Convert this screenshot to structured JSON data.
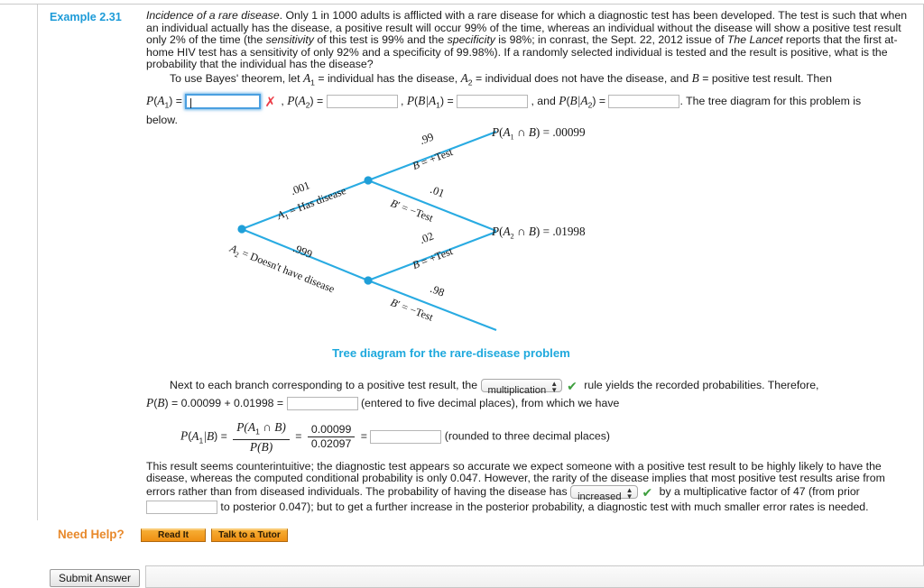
{
  "example": {
    "label": "Example 2.31",
    "title": "Incidence of a rare disease",
    "paragraph_1a": ". Only 1 in 1000 adults is afflicted with a rare disease for which a diagnostic test has been developed. The test is such that when an individual actually has the disease, a positive result will occur 99% of the time, whereas an individual without the disease will show a positive test result only 2% of the time (the ",
    "sensitivity_word": "sensitivity",
    "paragraph_1b": " of this test is 99% and the ",
    "specificity_word": "specificity",
    "paragraph_1c": " is 98%; in conrast, the Sept. 22, 2012 issue of ",
    "lancet": "The Lancet",
    "paragraph_1d": " reports that the first at-home HIV test has a sensitivity of only 92% and a specificity of 99.98%). If a randomly selected individual is tested and the result is positive, what is the probability that the individual has the disease?",
    "bayes_lead": "To use Bayes' theorem, let",
    "bayes_mid1": "= individual has the disease,",
    "bayes_mid2": "= individual does not have the disease, and",
    "bayes_mid3": "= positive test result. Then",
    "below_word": "below."
  },
  "answers": {
    "pa1_label_p": "P",
    "pa1_value": "",
    "pa1_status": "incorrect",
    "pa2_value": "",
    "pba1_value": "",
    "pba2_value": "",
    "pba2_tail": ". The tree diagram for this problem is",
    "pb_value": "",
    "posterior_value": "",
    "prior_value": ""
  },
  "icons": {
    "incorrect_mark": "✗",
    "correct_mark": "✔",
    "select_arrows": "⇅"
  },
  "tree": {
    "caption": "Tree diagram for the rare-disease problem",
    "branches": {
      "p_a1": ".001",
      "a1_label": "= Has disease",
      "p_a2": ".999",
      "a2_label": "= Doesn't have disease",
      "p_b_given_a1": ".99",
      "b_pos_label_1": "= +Test",
      "p_bprime_given_a1": ".01",
      "b_neg_label_1": "= −Test",
      "p_b_given_a2": ".02",
      "b_pos_label_2": "= +Test",
      "p_bprime_given_a2": ".98",
      "b_neg_label_2": "= −Test"
    },
    "results": {
      "joint_1_value": ".00099",
      "joint_2_value": ".01998"
    },
    "line_color": "#29abe2",
    "node_color": "#1f9fd8"
  },
  "conclusion": {
    "next_to_lead": "Next to each branch corresponding to a positive test result, the",
    "rule_select_value": "multiplication",
    "rule_select_status": "correct",
    "next_to_tail": "rule yields the recorded probabilities. Therefore,",
    "pb_expr": "0.00099 + 0.01998 =",
    "pb_note": "(entered to five decimal places), from which we have",
    "frac_numerator": "0.00099",
    "frac_denominator": "0.02097",
    "rounded_note": "(rounded to three decimal places)",
    "final_a": "This result seems counterintuitive; the diagnostic test appears so accurate we expect someone with a positive test result to be highly likely to have the disease, whereas the computed conditional probability is only 0.047. However, the rarity of the disease implies that most positive test results arise from errors rather than from diseased individuals. The probability of having the disease has",
    "trend_select_value": "increased",
    "trend_select_status": "correct",
    "final_b": "by a multiplicative factor of 47 (from prior",
    "final_c": "to posterior 0.047); but to get a further increase in the posterior probability, a diagnostic test with much smaller error rates is needed."
  },
  "help": {
    "need_help": "Need Help?",
    "read_it": "Read It",
    "talk_to_tutor": "Talk to a Tutor"
  },
  "footer": {
    "submit": "Submit Answer"
  },
  "colors": {
    "example_label": "#1d9bd8",
    "caption": "#1fa9dd",
    "tree_line": "#29abe2",
    "need_help": "#e8892b",
    "button_orange": "#f29b1c",
    "incorrect": "#ec3b46",
    "correct": "#3d9e3d"
  }
}
